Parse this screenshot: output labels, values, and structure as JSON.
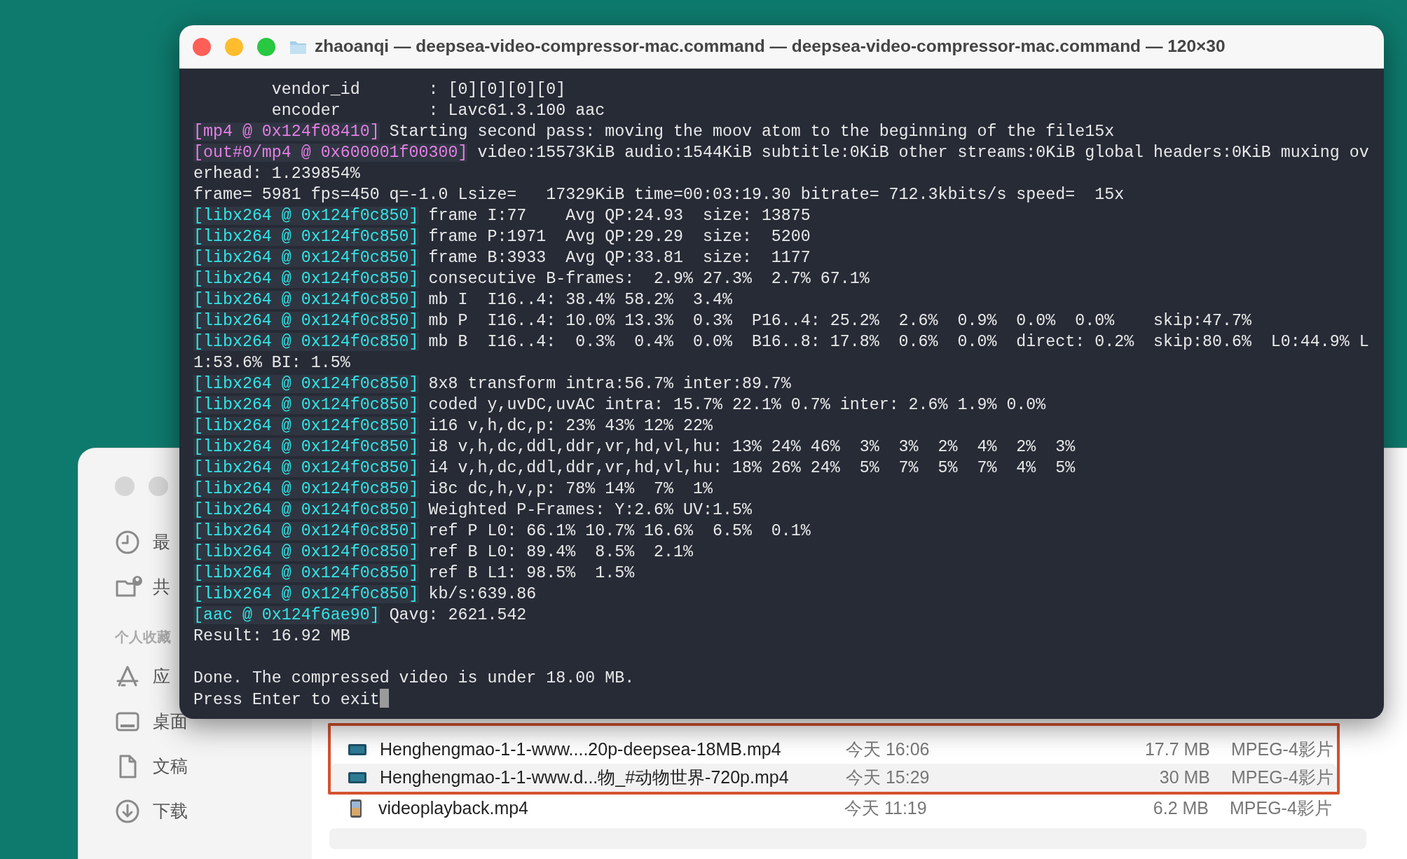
{
  "finder": {
    "sidebar": [
      {
        "kind": "item",
        "label": "最"
      },
      {
        "kind": "item",
        "label": "共"
      },
      {
        "kind": "header",
        "label": "个人收藏"
      },
      {
        "kind": "item",
        "label": "应"
      },
      {
        "kind": "item",
        "label": "桌面"
      },
      {
        "kind": "item",
        "label": "文稿"
      },
      {
        "kind": "item",
        "label": "下载"
      }
    ],
    "files": [
      {
        "kind": "video",
        "name": "Henghengmao-1-1-www....20p-deepsea-18MB.mp4",
        "date": "今天 16:06",
        "size": "17.7 MB",
        "type": "MPEG-4影片",
        "highlighted": true
      },
      {
        "kind": "video",
        "name": "Henghengmao-1-1-www.d...物_#动物世界-720p.mp4",
        "date": "今天 15:29",
        "size": "30 MB",
        "type": "MPEG-4影片",
        "highlighted": true
      },
      {
        "kind": "thumbnail",
        "name": "videoplayback.mp4",
        "date": "今天 11:19",
        "size": "6.2 MB",
        "type": "MPEG-4影片",
        "highlighted": false
      }
    ]
  },
  "terminal": {
    "title": "zhaoanqi — deepsea-video-compressor-mac.command — deepsea-video-compressor-mac.command — 120×30",
    "cursor": true,
    "lines": [
      {
        "text": "        vendor_id       : [0][0][0][0]"
      },
      {
        "text": "        encoder         : Lavc61.3.100 aac"
      },
      {
        "prefix": "[mp4 @ 0x124f08410]",
        "color": "#e57ee6",
        "text": "Starting second pass: moving the moov atom to the beginning of the file15x"
      },
      {
        "prefix": "[out#0/mp4 @ 0x600001f00300]",
        "color": "#e57ee6",
        "text": "video:15573KiB audio:1544KiB subtitle:0KiB other streams:0KiB global headers:0KiB muxing ov"
      },
      {
        "text": "erhead: 1.239854%"
      },
      {
        "text": "frame= 5981 fps=450 q=-1.0 Lsize=   17329KiB time=00:03:19.30 bitrate= 712.3kbits/s speed=  15x"
      },
      {
        "prefix": "[libx264 @ 0x124f0c850]",
        "color": "#33e3e6",
        "text": "frame I:77    Avg QP:24.93  size: 13875"
      },
      {
        "prefix": "[libx264 @ 0x124f0c850]",
        "color": "#33e3e6",
        "text": "frame P:1971  Avg QP:29.29  size:  5200"
      },
      {
        "prefix": "[libx264 @ 0x124f0c850]",
        "color": "#33e3e6",
        "text": "frame B:3933  Avg QP:33.81  size:  1177"
      },
      {
        "prefix": "[libx264 @ 0x124f0c850]",
        "color": "#33e3e6",
        "text": "consecutive B-frames:  2.9% 27.3%  2.7% 67.1%"
      },
      {
        "prefix": "[libx264 @ 0x124f0c850]",
        "color": "#33e3e6",
        "text": "mb I  I16..4: 38.4% 58.2%  3.4%"
      },
      {
        "prefix": "[libx264 @ 0x124f0c850]",
        "color": "#33e3e6",
        "text": "mb P  I16..4: 10.0% 13.3%  0.3%  P16..4: 25.2%  2.6%  0.9%  0.0%  0.0%    skip:47.7%"
      },
      {
        "prefix": "[libx264 @ 0x124f0c850]",
        "color": "#33e3e6",
        "text": "mb B  I16..4:  0.3%  0.4%  0.0%  B16..8: 17.8%  0.6%  0.0%  direct: 0.2%  skip:80.6%  L0:44.9% L"
      },
      {
        "text": "1:53.6% BI: 1.5%"
      },
      {
        "prefix": "[libx264 @ 0x124f0c850]",
        "color": "#33e3e6",
        "text": "8x8 transform intra:56.7% inter:89.7%"
      },
      {
        "prefix": "[libx264 @ 0x124f0c850]",
        "color": "#33e3e6",
        "text": "coded y,uvDC,uvAC intra: 15.7% 22.1% 0.7% inter: 2.6% 1.9% 0.0%"
      },
      {
        "prefix": "[libx264 @ 0x124f0c850]",
        "color": "#33e3e6",
        "text": "i16 v,h,dc,p: 23% 43% 12% 22%"
      },
      {
        "prefix": "[libx264 @ 0x124f0c850]",
        "color": "#33e3e6",
        "text": "i8 v,h,dc,ddl,ddr,vr,hd,vl,hu: 13% 24% 46%  3%  3%  2%  4%  2%  3%"
      },
      {
        "prefix": "[libx264 @ 0x124f0c850]",
        "color": "#33e3e6",
        "text": "i4 v,h,dc,ddl,ddr,vr,hd,vl,hu: 18% 26% 24%  5%  7%  5%  7%  4%  5%"
      },
      {
        "prefix": "[libx264 @ 0x124f0c850]",
        "color": "#33e3e6",
        "text": "i8c dc,h,v,p: 78% 14%  7%  1%"
      },
      {
        "prefix": "[libx264 @ 0x124f0c850]",
        "color": "#33e3e6",
        "text": "Weighted P-Frames: Y:2.6% UV:1.5%"
      },
      {
        "prefix": "[libx264 @ 0x124f0c850]",
        "color": "#33e3e6",
        "text": "ref P L0: 66.1% 10.7% 16.6%  6.5%  0.1%"
      },
      {
        "prefix": "[libx264 @ 0x124f0c850]",
        "color": "#33e3e6",
        "text": "ref B L0: 89.4%  8.5%  2.1%"
      },
      {
        "prefix": "[libx264 @ 0x124f0c850]",
        "color": "#33e3e6",
        "text": "ref B L1: 98.5%  1.5%"
      },
      {
        "prefix": "[libx264 @ 0x124f0c850]",
        "color": "#33e3e6",
        "text": "kb/s:639.86"
      },
      {
        "prefix": "[aac @ 0x124f6ae90]",
        "color": "#33e3e6",
        "text": "Qavg: 2621.542"
      },
      {
        "text": "Result: 16.92 MB"
      }
    ],
    "closing_lines": [
      {
        "text": "Done. The compressed video is under 18.00 MB."
      },
      {
        "text": "Press Enter to exit"
      }
    ]
  }
}
